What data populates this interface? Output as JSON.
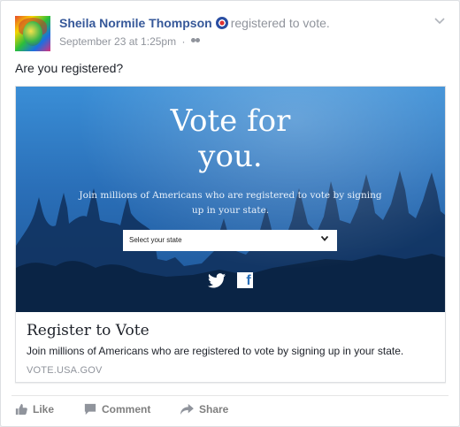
{
  "post": {
    "author": "Sheila Normile Thompson",
    "action": "registered to vote.",
    "timestamp": "September 23 at 1:25pm",
    "separator": "·",
    "audience_icon": "friends-icon",
    "menu_icon": "chevron-down-icon",
    "text": "Are you registered?"
  },
  "preview": {
    "hero_title_line1": "Vote for",
    "hero_title_line2": "you.",
    "hero_subtitle_line1": "Join millions of Americans who are registered to vote by signing",
    "hero_subtitle_line2": "up in your state.",
    "select_value": "Select your state",
    "share_icons": [
      "twitter-icon",
      "facebook-icon"
    ],
    "title": "Register to Vote",
    "description": "Join millions of Americans who are registered to vote by signing up in your state.",
    "domain": "VOTE.USA.GOV"
  },
  "actions": {
    "like": "Like",
    "comment": "Comment",
    "share": "Share"
  },
  "colors": {
    "author_link": "#365899",
    "hero_blue": "#2a6fb8",
    "meta_gray": "#90949c"
  }
}
